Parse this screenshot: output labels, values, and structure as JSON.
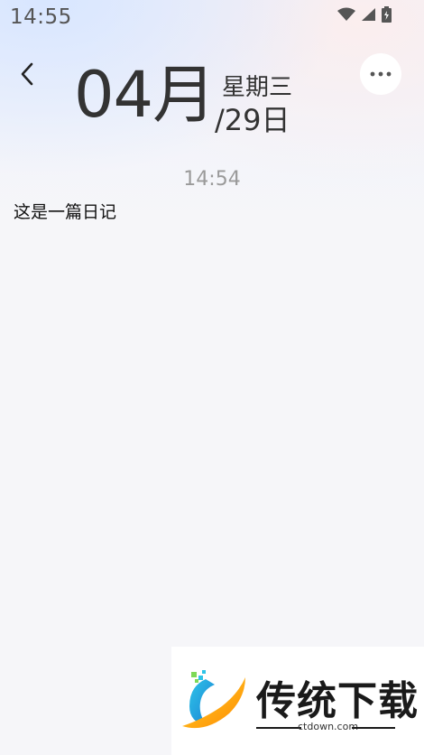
{
  "status_bar": {
    "time": "14:55"
  },
  "header": {
    "month": "04月",
    "weekday": "星期三",
    "day": "/29日"
  },
  "entry": {
    "time": "14:54",
    "text": "这是一篇日记"
  },
  "icons": {
    "back": "chevron-left-icon",
    "more": "more-dots-icon",
    "wifi": "wifi-icon",
    "signal": "signal-icon",
    "battery": "battery-icon"
  },
  "watermark": {
    "title": "传统下载",
    "url": "ctdown.com"
  }
}
